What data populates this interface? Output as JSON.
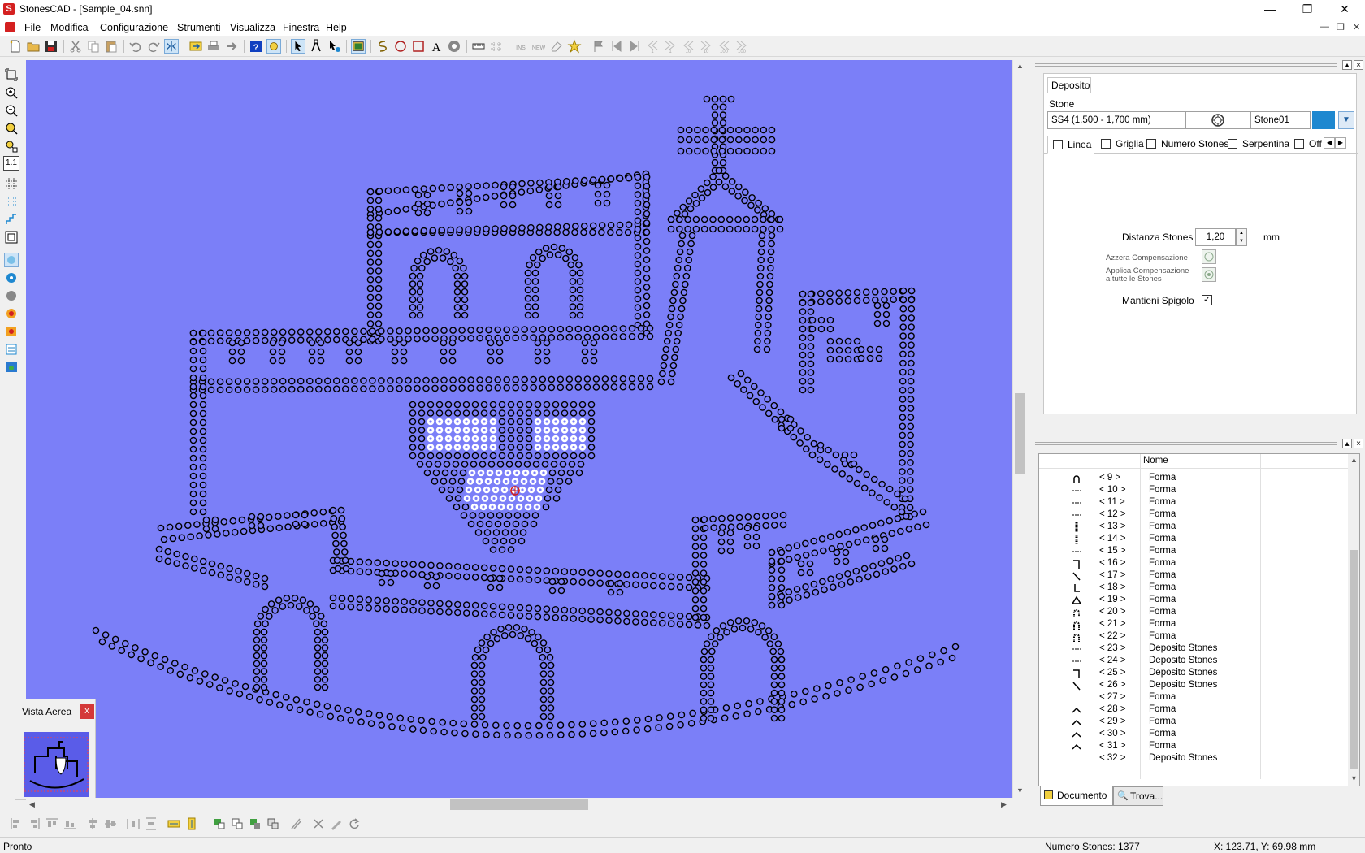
{
  "window": {
    "title": "StonesCAD - [Sample_04.snn]",
    "icon_label": "S"
  },
  "window_controls": {
    "minimize": "—",
    "restore": "❐",
    "close": "✕"
  },
  "menu": {
    "items": [
      "File",
      "Modifica",
      "Configurazione",
      "Strumenti",
      "Visualizza",
      "Finestra",
      "Help"
    ]
  },
  "toolbar": {
    "text_labels": {
      "ins": "INS",
      "new": "NEW",
      "n1a": "1",
      "n1b": "1",
      "n10a": "10",
      "n10b": "10",
      "n100a": "100",
      "n100b": "100"
    }
  },
  "left_tools": {
    "zoom_1_1": "1.1"
  },
  "aerial_view": {
    "title": "Vista Aerea",
    "close": "x"
  },
  "deposito": {
    "tab": "Deposito",
    "stone_label": "Stone",
    "stone_size": "SS4  (1,500 - 1,700 mm)",
    "stone_name": "Stone01",
    "stone_color": "#1e88d0",
    "tabs": [
      "Linea",
      "Griglia",
      "Numero Stones",
      "Serpentina",
      "Offs"
    ],
    "distanza_label": "Distanza Stones",
    "distanza_value": "1,20",
    "distanza_unit": "mm",
    "azzera_label": "Azzera Compensazione",
    "applica_label_1": "Applica Compensazione",
    "applica_label_2": "a tutte le Stones",
    "mantieni_label": "Mantieni Spigolo",
    "mantieni_checked": true
  },
  "document_tree": {
    "header": "Nome",
    "rows": [
      {
        "id": "< 9 >",
        "name": "Forma",
        "icon": "arch-icon"
      },
      {
        "id": "< 10 >",
        "name": "Forma",
        "icon": "dash-line-icon"
      },
      {
        "id": "< 11 >",
        "name": "Forma",
        "icon": "dash-line-icon"
      },
      {
        "id": "< 12 >",
        "name": "Forma",
        "icon": "dash-line-icon"
      },
      {
        "id": "< 13 >",
        "name": "Forma",
        "icon": "vertical-dots-icon"
      },
      {
        "id": "< 14 >",
        "name": "Forma",
        "icon": "vertical-dots-icon"
      },
      {
        "id": "< 15 >",
        "name": "Forma",
        "icon": "dash-line-icon"
      },
      {
        "id": "< 16 >",
        "name": "Forma",
        "icon": "corner-icon"
      },
      {
        "id": "< 17 >",
        "name": "Forma",
        "icon": "diagonal-icon"
      },
      {
        "id": "< 18 >",
        "name": "Forma",
        "icon": "bracket-icon"
      },
      {
        "id": "< 19 >",
        "name": "Forma",
        "icon": "triangle-icon"
      },
      {
        "id": "< 20 >",
        "name": "Forma",
        "icon": "dotted-arch-icon"
      },
      {
        "id": "< 21 >",
        "name": "Forma",
        "icon": "dotted-arch-icon"
      },
      {
        "id": "< 22 >",
        "name": "Forma",
        "icon": "dotted-arch-icon"
      },
      {
        "id": "< 23 >",
        "name": "Deposito Stones",
        "icon": "dash-line-icon"
      },
      {
        "id": "< 24 >",
        "name": "Deposito Stones",
        "icon": "dash-line-icon"
      },
      {
        "id": "< 25 >",
        "name": "Deposito Stones",
        "icon": "corner-icon"
      },
      {
        "id": "< 26 >",
        "name": "Deposito Stones",
        "icon": "diagonal-icon"
      },
      {
        "id": "< 27 >",
        "name": "Forma",
        "icon": "none"
      },
      {
        "id": "< 28 >",
        "name": "Forma",
        "icon": "caret-icon"
      },
      {
        "id": "< 29 >",
        "name": "Forma",
        "icon": "caret-icon"
      },
      {
        "id": "< 30 >",
        "name": "Forma",
        "icon": "caret-icon"
      },
      {
        "id": "< 31 >",
        "name": "Forma",
        "icon": "caret-icon"
      },
      {
        "id": "< 32 >",
        "name": "Deposito Stones",
        "icon": "none"
      }
    ]
  },
  "bottom_tabs": {
    "documento": "Documento",
    "trova": "Trova..."
  },
  "status": {
    "left": "Pronto",
    "count": "Numero Stones: 1377",
    "coords": "X: 123.71, Y: 69.98 mm"
  },
  "canvas": {
    "background": "#7b7ff8"
  }
}
